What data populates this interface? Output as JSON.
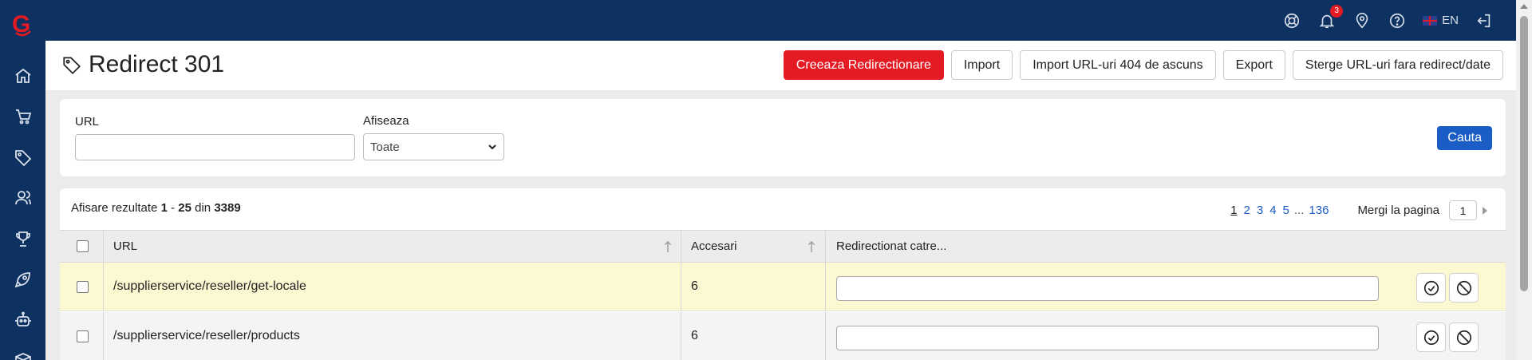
{
  "topbar": {
    "notification_count": "3",
    "language": "EN",
    "icons": [
      "support-icon",
      "bell-icon",
      "location-pin-icon",
      "help-icon",
      "logout-icon"
    ]
  },
  "sidebar": {
    "logo_letter": "G",
    "items": [
      {
        "name": "home",
        "icon": "home-icon"
      },
      {
        "name": "orders",
        "icon": "cart-icon"
      },
      {
        "name": "products",
        "icon": "tag-icon"
      },
      {
        "name": "customers",
        "icon": "users-icon"
      },
      {
        "name": "marketing",
        "icon": "trophy-icon"
      },
      {
        "name": "launch",
        "icon": "rocket-icon"
      },
      {
        "name": "automation",
        "icon": "robot-icon"
      },
      {
        "name": "more",
        "icon": "box-icon"
      }
    ]
  },
  "page": {
    "title": "Redirect 301"
  },
  "actions": {
    "create": "Creeaza Redirectionare",
    "import": "Import",
    "import_404": "Import URL-uri 404 de ascuns",
    "export": "Export",
    "delete": "Sterge URL-uri fara redirect/date"
  },
  "filters": {
    "url_label": "URL",
    "url_value": "",
    "show_label": "Afiseaza",
    "show_value": "Toate",
    "search_label": "Cauta"
  },
  "results": {
    "summary_prefix": "Afisare rezultate",
    "range_start": "1",
    "range_sep": "-",
    "range_end": "25",
    "of_word": "din",
    "total": "3389",
    "pages": [
      "1",
      "2",
      "3",
      "4",
      "5"
    ],
    "ellipsis": "...",
    "last_page": "136",
    "goto_label": "Mergi la pagina",
    "goto_value": "1"
  },
  "table": {
    "columns": {
      "url": "URL",
      "hits": "Accesari",
      "redirect": "Redirectionat catre..."
    },
    "rows": [
      {
        "url": "/supplierservice/reseller/get-locale",
        "hits": "6",
        "redirect": ""
      },
      {
        "url": "/supplierservice/reseller/products",
        "hits": "6",
        "redirect": ""
      }
    ]
  },
  "colors": {
    "navy": "#0d3161",
    "primary_red": "#e41b23",
    "search_blue": "#1a5dc5",
    "highlight_row": "#fbf8d2"
  }
}
